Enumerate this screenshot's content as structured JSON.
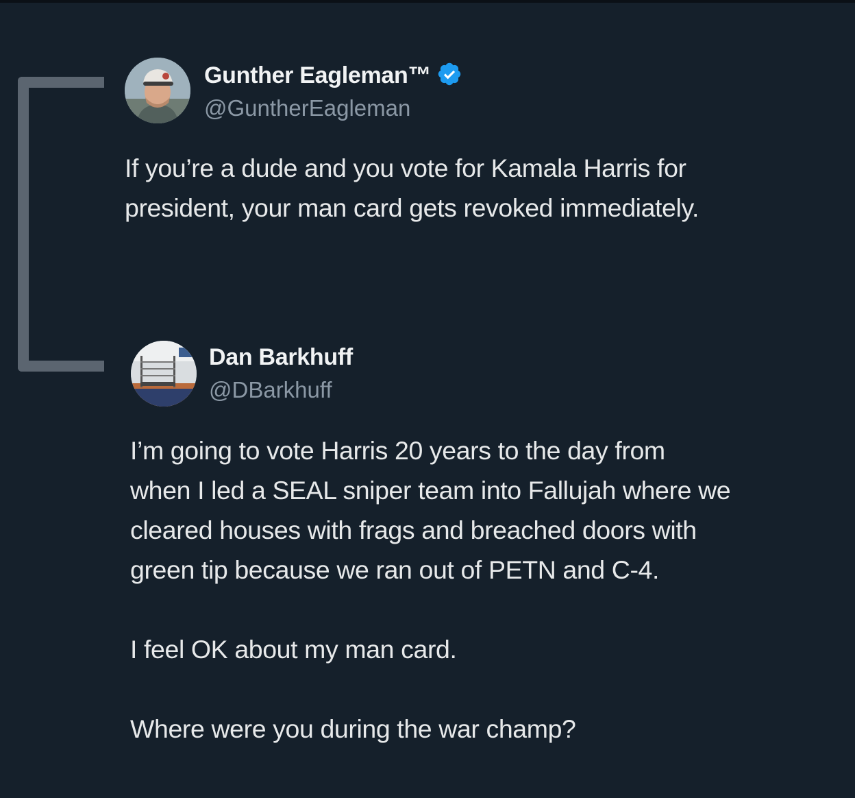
{
  "tweets": [
    {
      "display_name": "Gunther Eagleman™",
      "handle": "@GuntherEagleman",
      "verified": true,
      "avatar_icon": "man-in-cap-avatar",
      "text_lines": [
        "If you’re a dude and you vote for Kamala Harris for",
        "president, your man card gets revoked immediately."
      ]
    },
    {
      "display_name": "Dan Barkhuff",
      "handle": "@DBarkhuff",
      "verified": false,
      "avatar_icon": "boxing-ring-avatar",
      "paragraphs": [
        [
          "I’m going to vote Harris 20 years to the day from",
          "when I led a SEAL sniper team into Fallujah where we",
          "cleared houses with frags and breached doors with",
          "green tip because we ran out of PETN and C-4."
        ],
        [
          "I feel OK about my man card."
        ],
        [
          "Where were you during the war champ?"
        ]
      ]
    }
  ],
  "colors": {
    "background": "#15202b",
    "thread_line": "#5b6570",
    "handle": "#8b98a5",
    "verified_badge": "#1d9bf0"
  }
}
